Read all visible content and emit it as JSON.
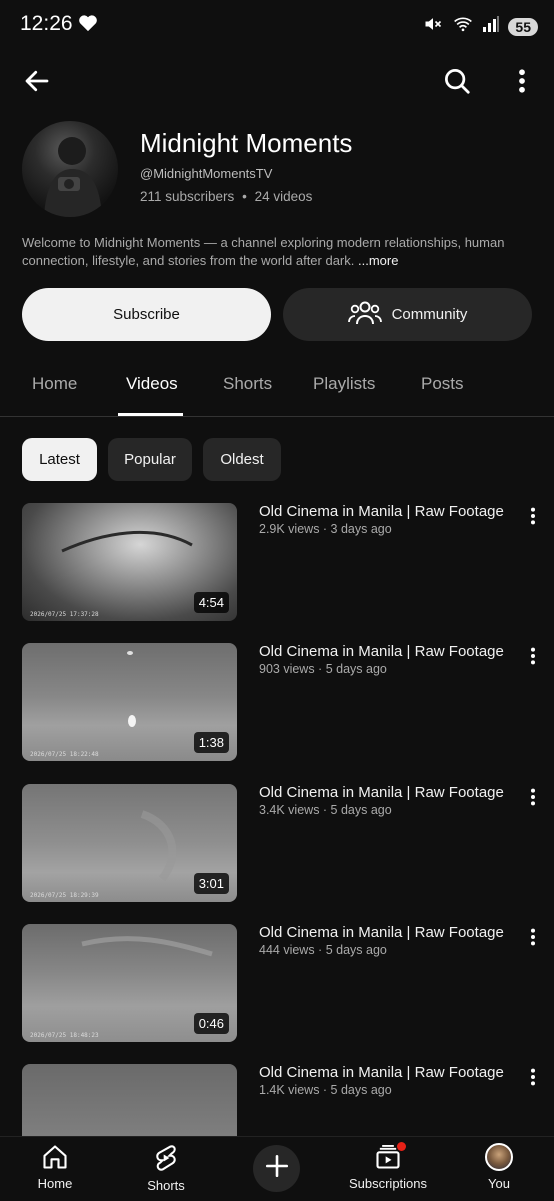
{
  "status_bar": {
    "time": "12:26",
    "battery": "55"
  },
  "channel": {
    "name": "Midnight Moments",
    "handle": "@MidnightMomentsTV",
    "subscribers": "211 subscribers",
    "separator": "•",
    "videos_count": "24 videos",
    "description": "Welcome to Midnight Moments — a channel exploring modern relationships, human connection, lifestyle, and stories from the world after dark. ",
    "more_label": "...more"
  },
  "actions": {
    "subscribe_label": "Subscribe",
    "community_label": "Community"
  },
  "tabs": [
    {
      "label": "Home"
    },
    {
      "label": "Videos"
    },
    {
      "label": "Shorts"
    },
    {
      "label": "Playlists"
    },
    {
      "label": "Posts"
    }
  ],
  "active_tab": "Videos",
  "chips": [
    {
      "label": "Latest"
    },
    {
      "label": "Popular"
    },
    {
      "label": "Oldest"
    }
  ],
  "videos": [
    {
      "title": "Old Cinema in Manila | Raw Footage",
      "meta": "2.9K views · 3 days ago",
      "duration": "4:54",
      "timestamp": "2026/07/25  17:37:28"
    },
    {
      "title": "Old Cinema in Manila | Raw Footage",
      "meta": "903 views · 5 days ago",
      "duration": "1:38",
      "timestamp": "2026/07/25  18:22:48"
    },
    {
      "title": "Old Cinema in Manila | Raw Footage",
      "meta": "3.4K views · 5 days ago",
      "duration": "3:01",
      "timestamp": "2026/07/25  18:29:39"
    },
    {
      "title": "Old Cinema in Manila | Raw Footage",
      "meta": "444 views · 5 days ago",
      "duration": "0:46",
      "timestamp": "2026/07/25  18:48:23"
    },
    {
      "title": "Old Cinema in Manila | Raw Footage",
      "meta": "1.4K views · 5 days ago",
      "duration": "",
      "timestamp": ""
    }
  ],
  "bottom_nav": [
    {
      "label": "Home"
    },
    {
      "label": "Shorts"
    },
    {
      "label": "Subscriptions"
    },
    {
      "label": "You"
    }
  ],
  "colors": {
    "background": "#0f0f0f",
    "chip_active": "#f1f1f1",
    "chip": "#272727",
    "notification_dot": "#e62117"
  }
}
